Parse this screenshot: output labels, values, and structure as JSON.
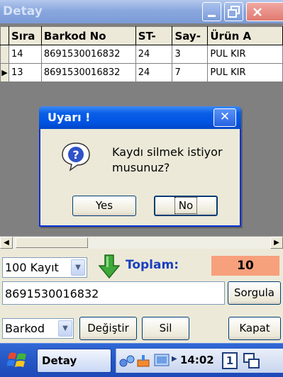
{
  "window": {
    "title": "Detay"
  },
  "grid": {
    "columns": [
      "Sıra",
      "Barkod No",
      "ST-",
      "Say-",
      "Ürün A"
    ],
    "rows": [
      {
        "marker": "",
        "sira": "14",
        "barkod": "8691530016832",
        "st": "24",
        "say": "3",
        "urun": "PUL KIR"
      },
      {
        "marker": "▶",
        "sira": "13",
        "barkod": "8691530016832",
        "st": "24",
        "say": "7",
        "urun": "PUL KIR"
      }
    ]
  },
  "controls": {
    "record_count_selected": "100 Kayıt",
    "toplam_label": "Toplam:",
    "toplam_value": "10",
    "barcode_value": "8691530016832",
    "sorgula_label": "Sorgula",
    "field_selected": "Barkod",
    "degistir_label": "Değiştir",
    "sil_label": "Sil",
    "kapat_label": "Kapat"
  },
  "dialog": {
    "title": "Uyarı !",
    "message": "Kaydı silmek istiyor musunuz?",
    "yes_label": "Yes",
    "no_label": "No"
  },
  "taskbar": {
    "app_label": "Detay",
    "clock": "14:02",
    "keyboard_indicator": "1"
  },
  "colors": {
    "toplam_label": "#1a3fbf",
    "toplam_value_bg": "#f7a07c",
    "dialog_title_bg": "#0054e3",
    "taskbar_bg": "#2457c5"
  }
}
